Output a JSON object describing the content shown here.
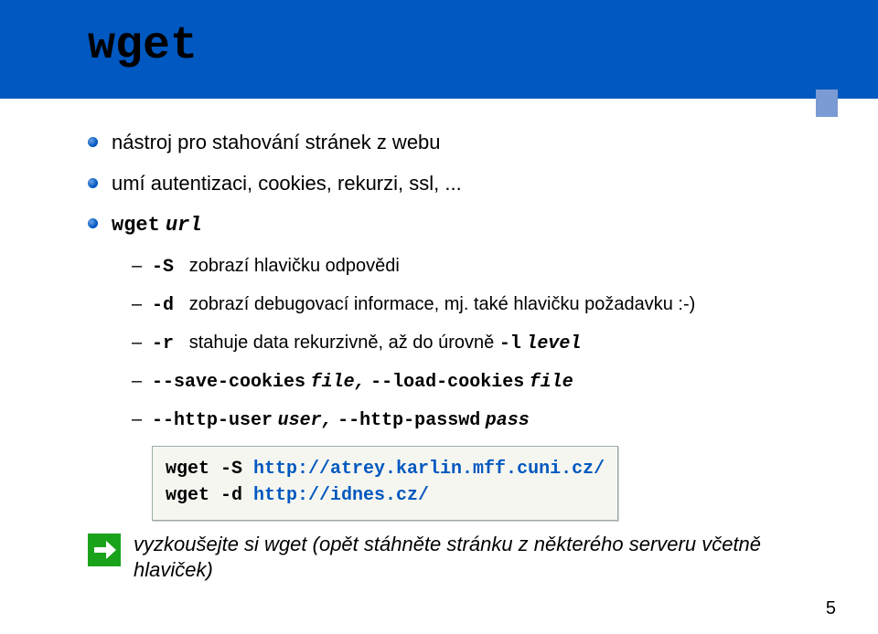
{
  "title": "wget",
  "bullets": {
    "b1": "nástroj pro stahování stránek z webu",
    "b2": "umí autentizaci, cookies, rekurzi, ssl, ...",
    "b3_cmd": "wget",
    "b3_arg": "url"
  },
  "opts": {
    "S_flag": "-S",
    "S_desc": "zobrazí hlavičku odpovědi",
    "d_flag": "-d",
    "d_desc": "zobrazí debugovací informace, mj. také hlavičku požadavku :-)",
    "r_flag": "-r",
    "r_desc_a": "stahuje data rekurzivně, až do úrovně",
    "r_l": "-l",
    "r_level": "level",
    "save_a": "--save-cookies",
    "save_file": "file,",
    "load_a": "--load-cookies",
    "load_file": "file",
    "http_user_a": "--http-user",
    "http_user_v": "user,",
    "http_pass_a": "--http-passwd",
    "http_pass_v": "pass"
  },
  "code": {
    "line1_cmd": "wget -S ",
    "line1_url": "http://atrey.karlin.mff.cuni.cz/",
    "line2_cmd": "wget -d ",
    "line2_url": "http://idnes.cz/"
  },
  "exercise": "vyzkoušejte si wget (opět stáhněte stránku z některého serveru včetně hlaviček)",
  "page": "5"
}
